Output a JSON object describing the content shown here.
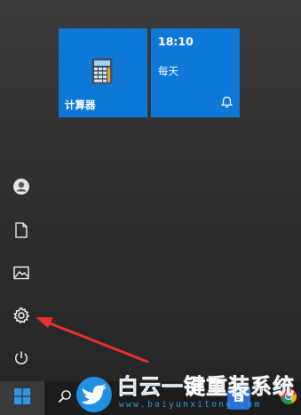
{
  "tiles": {
    "calculator": {
      "label": "计算器",
      "icon": "calculator-icon"
    },
    "alarm": {
      "time": "18:10",
      "repeat": "每天",
      "icon": "bell-icon"
    }
  },
  "rail": {
    "items": [
      {
        "name": "account",
        "icon": "user-icon"
      },
      {
        "name": "documents",
        "icon": "document-icon"
      },
      {
        "name": "pictures",
        "icon": "picture-icon"
      },
      {
        "name": "settings",
        "icon": "gear-icon"
      },
      {
        "name": "power",
        "icon": "power-icon"
      }
    ]
  },
  "taskbar": {
    "start_icon": "windows-logo-icon",
    "search_icon": "search-icon"
  },
  "watermark": {
    "title": "白云一键重装系统",
    "url": "www.baiyunxitong.com"
  },
  "colors": {
    "tile_accent": "#0e78d8",
    "annotation_arrow": "#e8302a",
    "watermark": "#2a9ae6"
  }
}
